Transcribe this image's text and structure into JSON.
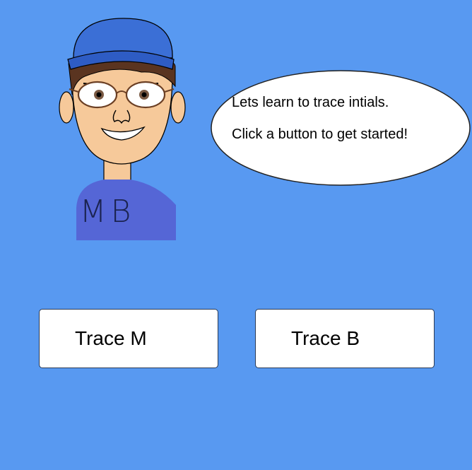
{
  "speech_bubble": {
    "line1": "Lets learn to trace intials.",
    "line2": "Click a button to get started!"
  },
  "character": {
    "shirt_letters": "MB",
    "icon": "teacher-avatar"
  },
  "buttons": {
    "trace_m_label": "Trace M",
    "trace_b_label": "Trace B"
  },
  "colors": {
    "background": "#5899f1",
    "cap": "#3b6fd6",
    "shirt": "#5566d6",
    "skin": "#f6c99a"
  }
}
